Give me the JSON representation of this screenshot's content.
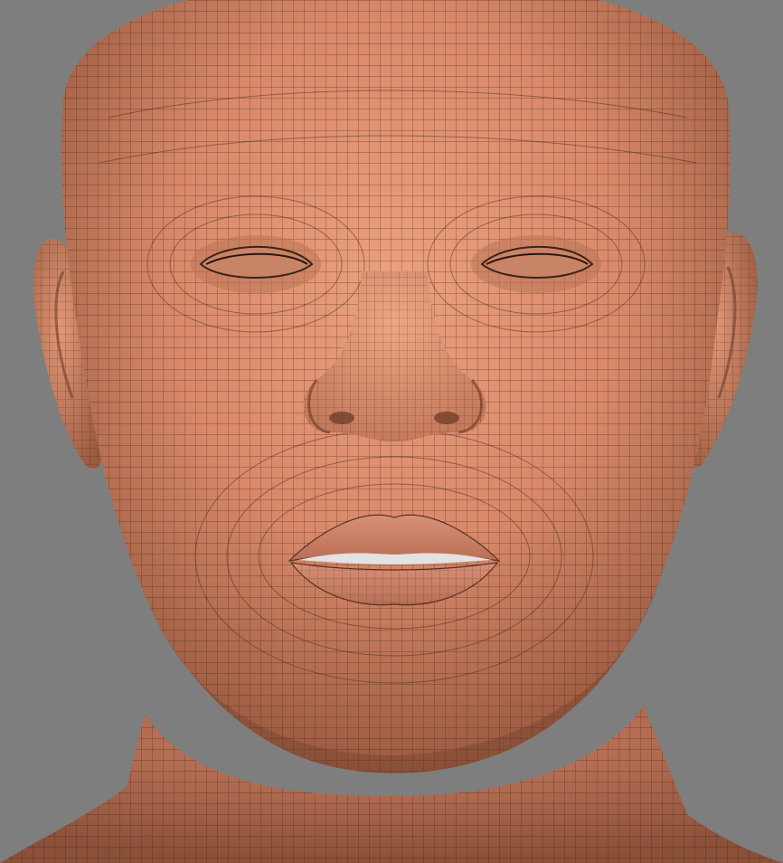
{
  "scene": {
    "subject": "head-mesh",
    "background_color": "#7e7e7e",
    "skin_color": "#d9896a",
    "skin_highlight": "#eba07d",
    "skin_shadow": "#7a4a36",
    "wire_color": "#3b2418",
    "lip_color": "#c9826a",
    "eye_color": "#a8694f",
    "mouth_gap_color": "#e2e2e2"
  }
}
